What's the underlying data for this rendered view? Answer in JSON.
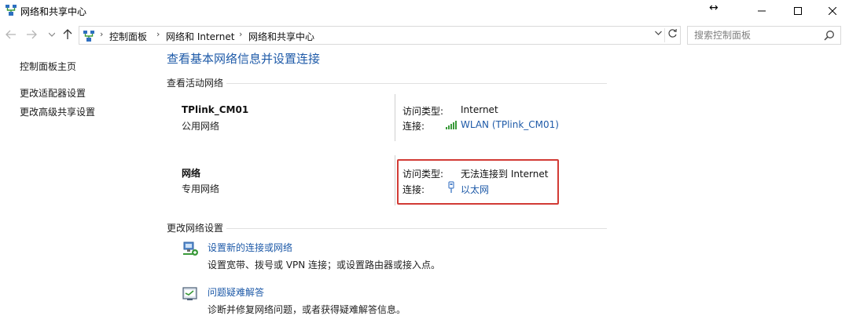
{
  "window": {
    "title": "网络和共享中心",
    "resize_glyph": "↔"
  },
  "address": {
    "breadcrumbs": [
      "控制面板",
      "网络和 Internet",
      "网络和共享中心"
    ],
    "separator": "›",
    "search_placeholder": "搜索控制面板"
  },
  "sidebar": {
    "items": [
      {
        "label": "控制面板主页"
      },
      {
        "label": "更改适配器设置"
      },
      {
        "label": "更改高级共享设置"
      }
    ]
  },
  "main": {
    "heading": "查看基本网络信息并设置连接",
    "active_section_title": "查看活动网络",
    "networks": [
      {
        "name": "TPlink_CM01",
        "type": "公用网络",
        "access_label": "访问类型:",
        "access_value": "Internet",
        "conn_label": "连接:",
        "conn_value": "WLAN (TPlink_CM01)",
        "conn_icon": "wifi-signal-icon"
      },
      {
        "name": "网络",
        "type": "专用网络",
        "access_label": "访问类型:",
        "access_value": "无法连接到 Internet",
        "conn_label": "连接:",
        "conn_value": "以太网",
        "conn_icon": "ethernet-icon",
        "highlighted": true
      }
    ],
    "change_section_title": "更改网络设置",
    "tasks": [
      {
        "icon": "new-connection-icon",
        "link": "设置新的连接或网络",
        "desc": "设置宽带、拨号或 VPN 连接；或设置路由器或接入点。"
      },
      {
        "icon": "troubleshoot-icon",
        "link": "问题疑难解答",
        "desc": "诊断并修复网络问题，或者获得疑难解答信息。"
      }
    ]
  },
  "colors": {
    "link": "#1e5aa8",
    "highlight": "#d23b35",
    "signal": "#3a9a3a"
  }
}
